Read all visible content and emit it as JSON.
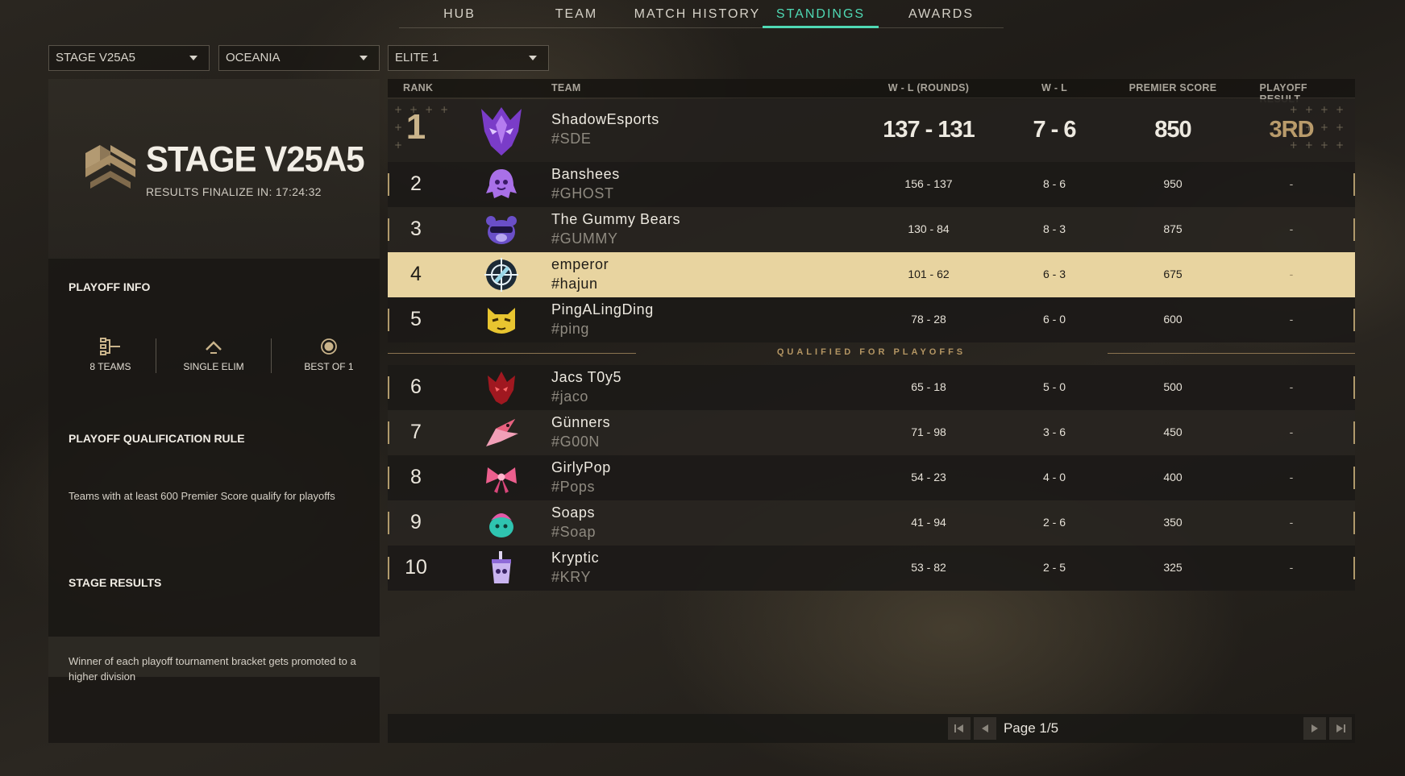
{
  "nav": {
    "tabs": [
      {
        "label": "HUB",
        "active": false
      },
      {
        "label": "TEAM",
        "active": false
      },
      {
        "label": "MATCH HISTORY",
        "active": false
      },
      {
        "label": "STANDINGS",
        "active": true
      },
      {
        "label": "AWARDS",
        "active": false
      }
    ],
    "active_color": "#4fd9b4"
  },
  "filters": {
    "stage": "STAGE V25A5",
    "region": "OCEANIA",
    "division": "ELITE 1"
  },
  "stage": {
    "title": "STAGE V25A5",
    "subtitle": "RESULTS FINALIZE IN: 17:24:32"
  },
  "playoff_info": {
    "title": "PLAYOFF INFO",
    "items": [
      {
        "icon": "bracket-icon",
        "label": "8 TEAMS"
      },
      {
        "icon": "chevron-up-icon",
        "label": "SINGLE ELIM"
      },
      {
        "icon": "target-circle-icon",
        "label": "BEST OF 1"
      }
    ]
  },
  "qualification": {
    "title": "PLAYOFF QUALIFICATION RULE",
    "text": "Teams with at least 600 Premier Score qualify for playoffs"
  },
  "stage_results": {
    "title": "STAGE RESULTS",
    "text": "Winner of each playoff tournament bracket gets promoted to a higher division"
  },
  "table": {
    "headers": {
      "rank": "RANK",
      "team": "TEAM",
      "wl_rounds": "W - L (ROUNDS)",
      "wl": "W - L",
      "premier_score": "PREMIER SCORE",
      "playoff_result": "PLAYOFF RESULT"
    },
    "rows": [
      {
        "rank": "1",
        "name": "ShadowEsports",
        "tag": "#SDE",
        "wl_rounds": "137 - 131",
        "wl": "7 - 6",
        "score": "850",
        "result": "3RD",
        "avatar": "purple-dragon-icon"
      },
      {
        "rank": "2",
        "name": "Banshees",
        "tag": "#GHOST",
        "wl_rounds": "156 - 137",
        "wl": "8 - 6",
        "score": "950",
        "result": "-",
        "avatar": "purple-ghost-icon"
      },
      {
        "rank": "3",
        "name": "The Gummy Bears",
        "tag": "#GUMMY",
        "wl_rounds": "130 - 84",
        "wl": "8 - 3",
        "score": "875",
        "result": "-",
        "avatar": "bear-icon"
      },
      {
        "rank": "4",
        "name": "emperor",
        "tag": "#hajun",
        "wl_rounds": "101 - 62",
        "wl": "6 - 3",
        "score": "675",
        "result": "-",
        "avatar": "crosshair-emblem-icon",
        "highlight": true
      },
      {
        "rank": "5",
        "name": "PingALingDing",
        "tag": "#ping",
        "wl_rounds": "78 - 28",
        "wl": "6 - 0",
        "score": "600",
        "result": "-",
        "avatar": "yellow-cat-icon"
      },
      {
        "rank": "6",
        "name": "Jacs T0y5",
        "tag": "#jaco",
        "wl_rounds": "65 - 18",
        "wl": "5 - 0",
        "score": "500",
        "result": "-",
        "avatar": "red-dragon-icon"
      },
      {
        "rank": "7",
        "name": "Günners",
        "tag": "#G00N",
        "wl_rounds": "71 - 98",
        "wl": "3 - 6",
        "score": "450",
        "result": "-",
        "avatar": "pink-bird-icon"
      },
      {
        "rank": "8",
        "name": "GirlyPop",
        "tag": "#Pops",
        "wl_rounds": "54 - 23",
        "wl": "4 - 0",
        "score": "400",
        "result": "-",
        "avatar": "pink-bow-icon"
      },
      {
        "rank": "9",
        "name": "Soaps",
        "tag": "#Soap",
        "wl_rounds": "41 - 94",
        "wl": "2 - 6",
        "score": "350",
        "result": "-",
        "avatar": "teal-creature-icon"
      },
      {
        "rank": "10",
        "name": "Kryptic",
        "tag": "#KRY",
        "wl_rounds": "53 - 82",
        "wl": "2 - 5",
        "score": "325",
        "result": "-",
        "avatar": "purple-cup-icon"
      }
    ],
    "qualified_label": "QUALIFIED FOR PLAYOFFS",
    "highlight_color": "#e8d4a0"
  },
  "pager": {
    "label": "Page 1/5"
  }
}
